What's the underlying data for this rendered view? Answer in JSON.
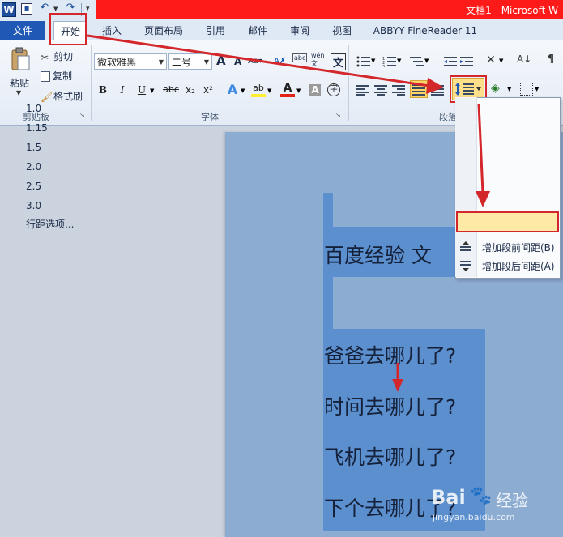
{
  "window": {
    "title": "文档1 - Microsoft W",
    "logo_letter": "W"
  },
  "tabs": [
    {
      "label": "文件"
    },
    {
      "label": "开始"
    },
    {
      "label": "插入"
    },
    {
      "label": "页面布局"
    },
    {
      "label": "引用"
    },
    {
      "label": "邮件"
    },
    {
      "label": "审阅"
    },
    {
      "label": "视图"
    },
    {
      "label": "ABBYY FineReader 11"
    }
  ],
  "clipboard": {
    "paste_label": "粘贴",
    "cut_label": "剪切",
    "copy_label": "复制",
    "format_painter_label": "格式刷",
    "group_label": "剪贴板"
  },
  "font": {
    "font_name": "微软雅黑",
    "font_size": "二号",
    "group_label": "字体",
    "wen": "wén",
    "char_sample": "文",
    "grow": "A",
    "shrink": "A",
    "bold": "B",
    "italic": "I",
    "underline": "U",
    "strike": "abc",
    "sub": "x₂",
    "sup": "x²",
    "effect": "A",
    "hl": "ab",
    "color": "A",
    "shade": "A",
    "circle": "字"
  },
  "paragraph": {
    "group_label": "段落"
  },
  "line_spacing_menu": {
    "items": [
      "1.0",
      "1.15",
      "1.5",
      "2.0",
      "2.5",
      "3.0"
    ],
    "options_label": "行距选项...",
    "add_before_label": "增加段前间距(B)",
    "add_after_label": "增加段后间距(A)"
  },
  "document": {
    "line1": "百度经验  文",
    "line2": "爸爸去哪儿了?",
    "line3": "时间去哪儿了?",
    "line4": "飞机去哪儿了?",
    "line5": "下个去哪儿了?"
  },
  "watermark": {
    "text": "经验",
    "url": "jingyan.baidu.com",
    "brand": "Bai"
  },
  "colors": {
    "accent_red": "#d4272b",
    "selection_blue": "#5b8fce",
    "file_tab_blue": "#1f59b5"
  }
}
